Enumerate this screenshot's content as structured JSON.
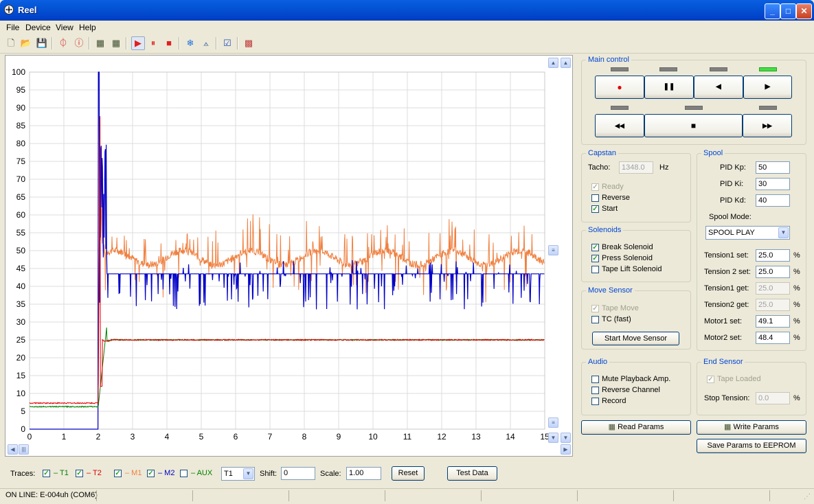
{
  "window": {
    "title": "Reel"
  },
  "menu": [
    "File",
    "Device",
    "View",
    "Help"
  ],
  "chart_data": {
    "type": "line",
    "xlim": [
      0,
      15
    ],
    "ylim": [
      0,
      100
    ],
    "x_ticks": [
      "0",
      "1",
      "2",
      "3",
      "4",
      "5",
      "6",
      "7",
      "8",
      "9",
      "10",
      "11",
      "12",
      "13",
      "14",
      "15"
    ],
    "y_ticks": [
      "0",
      "5",
      "10",
      "15",
      "20",
      "25",
      "30",
      "35",
      "40",
      "45",
      "50",
      "55",
      "60",
      "65",
      "70",
      "75",
      "80",
      "85",
      "90",
      "95",
      "100"
    ],
    "grid": true,
    "series": [
      {
        "name": "T1",
        "color": "#008000",
        "baseline": 6.3,
        "steady": 25,
        "peak": 29
      },
      {
        "name": "T2",
        "color": "#e00000",
        "baseline": 7.3,
        "steady": 25,
        "peak": 100
      },
      {
        "name": "M1",
        "color": "#f08040",
        "baseline": 0,
        "steady": 48,
        "peak": 100
      },
      {
        "name": "M2",
        "color": "#0000c8",
        "baseline": 0,
        "steady": 43.5,
        "peak": 100
      }
    ]
  },
  "main_control": {
    "title": "Main control",
    "buttons": [
      "●",
      "❚❚",
      "◀",
      "▶",
      "◀◀",
      "■",
      "▶▶"
    ]
  },
  "capstan": {
    "title": "Capstan",
    "tacho_label": "Tacho:",
    "tacho_value": "1348.0",
    "tacho_unit": "Hz",
    "ready": "Ready",
    "reverse": "Reverse",
    "start": "Start"
  },
  "solenoids": {
    "title": "Solenoids",
    "break": "Break Solenoid",
    "press": "Press Solenoid",
    "lift": "Tape Lift Solenoid"
  },
  "move_sensor": {
    "title": "Move Sensor",
    "tape_move": "Tape Move",
    "tc_fast": "TC (fast)",
    "start_button": "Start Move Sensor"
  },
  "audio": {
    "title": "Audio",
    "mute": "Mute Playback Amp.",
    "reverse_channel": "Reverse Channel",
    "record": "Record"
  },
  "spool": {
    "title": "Spool",
    "kp_label": "PID Kp:",
    "kp": "50",
    "ki_label": "PID Ki:",
    "ki": "30",
    "kd_label": "PID Kd:",
    "kd": "40",
    "mode_label": "Spool Mode:",
    "mode": "SPOOL PLAY",
    "t1set_label": "Tension1 set:",
    "t1set": "25.0",
    "t2set_label": "Tension 2 set:",
    "t2set": "25.0",
    "t1get_label": "Tension1 get:",
    "t1get": "25.0",
    "t2get_label": "Tension2 get:",
    "t2get": "25.0",
    "m1set_label": "Motor1 set:",
    "m1set": "49.1",
    "m2set_label": "Motor2 set:",
    "m2set": "48.4",
    "pct": "%"
  },
  "end_sensor": {
    "title": "End Sensor",
    "tape_loaded": "Tape Loaded",
    "stop_tension_label": "Stop Tension:",
    "stop_tension": "0.0",
    "pct": "%"
  },
  "buttons": {
    "read": "Read Params",
    "write": "Write Params",
    "save": "Save Params to EEPROM"
  },
  "traces": {
    "label": "Traces:",
    "t1": "– T1",
    "t2": "– T2",
    "m1": "– M1",
    "m2": "– M2",
    "aux": "– AUX",
    "select": "T1",
    "shift_label": "Shift:",
    "shift": "0",
    "scale_label": "Scale:",
    "scale": "1.00",
    "reset": "Reset",
    "test_data": "Test Data"
  },
  "status": {
    "text": "ON LINE: E-004uh (COM6)"
  }
}
